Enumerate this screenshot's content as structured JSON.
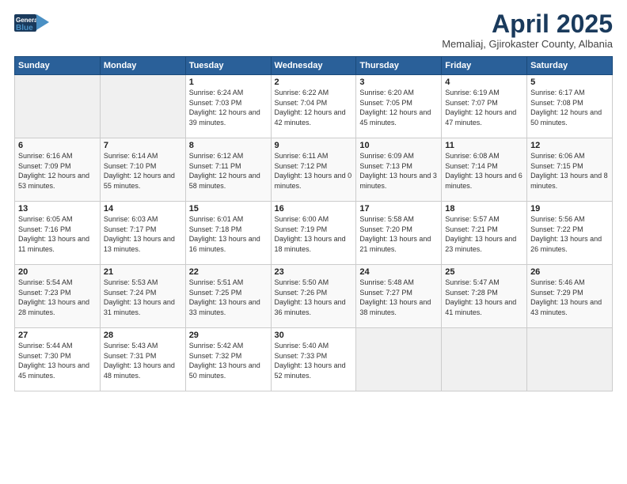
{
  "logo": {
    "line1": "General",
    "line2": "Blue"
  },
  "title": "April 2025",
  "subtitle": "Memaliaj, Gjirokaster County, Albania",
  "weekdays": [
    "Sunday",
    "Monday",
    "Tuesday",
    "Wednesday",
    "Thursday",
    "Friday",
    "Saturday"
  ],
  "weeks": [
    [
      {
        "day": "",
        "content": ""
      },
      {
        "day": "",
        "content": ""
      },
      {
        "day": "1",
        "content": "Sunrise: 6:24 AM\nSunset: 7:03 PM\nDaylight: 12 hours and 39 minutes."
      },
      {
        "day": "2",
        "content": "Sunrise: 6:22 AM\nSunset: 7:04 PM\nDaylight: 12 hours and 42 minutes."
      },
      {
        "day": "3",
        "content": "Sunrise: 6:20 AM\nSunset: 7:05 PM\nDaylight: 12 hours and 45 minutes."
      },
      {
        "day": "4",
        "content": "Sunrise: 6:19 AM\nSunset: 7:07 PM\nDaylight: 12 hours and 47 minutes."
      },
      {
        "day": "5",
        "content": "Sunrise: 6:17 AM\nSunset: 7:08 PM\nDaylight: 12 hours and 50 minutes."
      }
    ],
    [
      {
        "day": "6",
        "content": "Sunrise: 6:16 AM\nSunset: 7:09 PM\nDaylight: 12 hours and 53 minutes."
      },
      {
        "day": "7",
        "content": "Sunrise: 6:14 AM\nSunset: 7:10 PM\nDaylight: 12 hours and 55 minutes."
      },
      {
        "day": "8",
        "content": "Sunrise: 6:12 AM\nSunset: 7:11 PM\nDaylight: 12 hours and 58 minutes."
      },
      {
        "day": "9",
        "content": "Sunrise: 6:11 AM\nSunset: 7:12 PM\nDaylight: 13 hours and 0 minutes."
      },
      {
        "day": "10",
        "content": "Sunrise: 6:09 AM\nSunset: 7:13 PM\nDaylight: 13 hours and 3 minutes."
      },
      {
        "day": "11",
        "content": "Sunrise: 6:08 AM\nSunset: 7:14 PM\nDaylight: 13 hours and 6 minutes."
      },
      {
        "day": "12",
        "content": "Sunrise: 6:06 AM\nSunset: 7:15 PM\nDaylight: 13 hours and 8 minutes."
      }
    ],
    [
      {
        "day": "13",
        "content": "Sunrise: 6:05 AM\nSunset: 7:16 PM\nDaylight: 13 hours and 11 minutes."
      },
      {
        "day": "14",
        "content": "Sunrise: 6:03 AM\nSunset: 7:17 PM\nDaylight: 13 hours and 13 minutes."
      },
      {
        "day": "15",
        "content": "Sunrise: 6:01 AM\nSunset: 7:18 PM\nDaylight: 13 hours and 16 minutes."
      },
      {
        "day": "16",
        "content": "Sunrise: 6:00 AM\nSunset: 7:19 PM\nDaylight: 13 hours and 18 minutes."
      },
      {
        "day": "17",
        "content": "Sunrise: 5:58 AM\nSunset: 7:20 PM\nDaylight: 13 hours and 21 minutes."
      },
      {
        "day": "18",
        "content": "Sunrise: 5:57 AM\nSunset: 7:21 PM\nDaylight: 13 hours and 23 minutes."
      },
      {
        "day": "19",
        "content": "Sunrise: 5:56 AM\nSunset: 7:22 PM\nDaylight: 13 hours and 26 minutes."
      }
    ],
    [
      {
        "day": "20",
        "content": "Sunrise: 5:54 AM\nSunset: 7:23 PM\nDaylight: 13 hours and 28 minutes."
      },
      {
        "day": "21",
        "content": "Sunrise: 5:53 AM\nSunset: 7:24 PM\nDaylight: 13 hours and 31 minutes."
      },
      {
        "day": "22",
        "content": "Sunrise: 5:51 AM\nSunset: 7:25 PM\nDaylight: 13 hours and 33 minutes."
      },
      {
        "day": "23",
        "content": "Sunrise: 5:50 AM\nSunset: 7:26 PM\nDaylight: 13 hours and 36 minutes."
      },
      {
        "day": "24",
        "content": "Sunrise: 5:48 AM\nSunset: 7:27 PM\nDaylight: 13 hours and 38 minutes."
      },
      {
        "day": "25",
        "content": "Sunrise: 5:47 AM\nSunset: 7:28 PM\nDaylight: 13 hours and 41 minutes."
      },
      {
        "day": "26",
        "content": "Sunrise: 5:46 AM\nSunset: 7:29 PM\nDaylight: 13 hours and 43 minutes."
      }
    ],
    [
      {
        "day": "27",
        "content": "Sunrise: 5:44 AM\nSunset: 7:30 PM\nDaylight: 13 hours and 45 minutes."
      },
      {
        "day": "28",
        "content": "Sunrise: 5:43 AM\nSunset: 7:31 PM\nDaylight: 13 hours and 48 minutes."
      },
      {
        "day": "29",
        "content": "Sunrise: 5:42 AM\nSunset: 7:32 PM\nDaylight: 13 hours and 50 minutes."
      },
      {
        "day": "30",
        "content": "Sunrise: 5:40 AM\nSunset: 7:33 PM\nDaylight: 13 hours and 52 minutes."
      },
      {
        "day": "",
        "content": ""
      },
      {
        "day": "",
        "content": ""
      },
      {
        "day": "",
        "content": ""
      }
    ]
  ]
}
